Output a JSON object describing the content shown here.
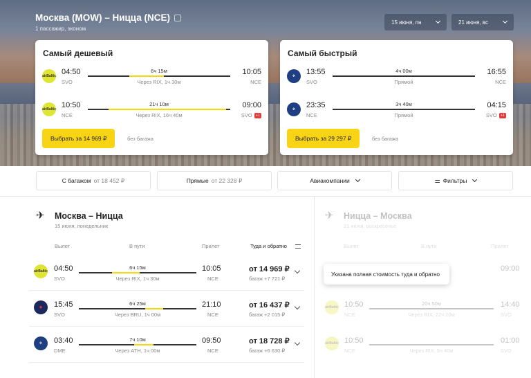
{
  "header": {
    "route": "Москва (MOW) – Ницца (NCE)",
    "subtitle": "1 пассажир, эконом",
    "date_out": "15 июня, пн",
    "date_back": "21 июня, вс"
  },
  "cheapest": {
    "title": "Самый дешевый",
    "flights": [
      {
        "logo": "airbaltic-logo",
        "logo_text": "airBaltic",
        "dep_time": "04:50",
        "dep_code": "SVO",
        "dur": "6ч 15м",
        "via": "Через RIX, 1ч 30м",
        "arr_time": "10:05",
        "arr_code": "NCE",
        "plus": ""
      },
      {
        "logo": "airbaltic-logo",
        "logo_text": "airBaltic",
        "dep_time": "10:50",
        "dep_code": "NCE",
        "dur": "21ч 10м",
        "via": "Через RIX, 16ч 40м",
        "arr_time": "09:00",
        "arr_code": "SVO",
        "plus": "+1"
      }
    ],
    "buy": "Выбрать за 14 969 ₽",
    "baggage": "без багажа"
  },
  "fastest": {
    "title": "Самый быстрый",
    "flights": [
      {
        "logo": "swiss-logo",
        "logo_text": "",
        "dep_time": "13:55",
        "dep_code": "SVO",
        "dur": "4ч 00м",
        "via": "Прямой",
        "arr_time": "16:55",
        "arr_code": "NCE",
        "plus": ""
      },
      {
        "logo": "swiss-logo",
        "logo_text": "",
        "dep_time": "23:35",
        "dep_code": "NCE",
        "dur": "3ч 40м",
        "via": "Прямой",
        "arr_time": "04:15",
        "arr_code": "SVO",
        "plus": "+1"
      }
    ],
    "buy": "Выбрать за 29 297 ₽",
    "baggage": "без багажа"
  },
  "filters": {
    "baggage": "С багажом",
    "baggage_price": "от 18 452 ₽",
    "direct": "Прямые",
    "direct_price": "от 22 328 ₽",
    "airlines": "Авиакомпании",
    "filters": "Фильтры"
  },
  "outbound": {
    "title": "Москва – Ницца",
    "date": "15 июня, понедельник",
    "cols": {
      "dep": "Вылет",
      "way": "В пути",
      "arr": "Прилет",
      "price": "Туда и обратно"
    },
    "rows": [
      {
        "logo_text": "airBaltic",
        "dep_time": "04:50",
        "dep_code": "SVO",
        "dur": "6ч 15м",
        "via": "Через RIX, 1ч 30м",
        "arr_time": "10:05",
        "arr_code": "NCE",
        "price": "от 14 969 ₽",
        "bag": "багаж +7 721 ₽"
      },
      {
        "logo_text": "",
        "dep_time": "15:45",
        "dep_code": "SVO",
        "dur": "6ч 25м",
        "via": "Через BRU, 1ч 00м",
        "arr_time": "21:10",
        "arr_code": "NCE",
        "price": "от 16 437 ₽",
        "bag": "багаж +2 015 ₽"
      },
      {
        "logo_text": "",
        "dep_time": "03:40",
        "dep_code": "DME",
        "dur": "7ч 10м",
        "via": "Через ATH, 1ч 00м",
        "arr_time": "09:50",
        "arr_code": "NCE",
        "price": "от 18 728 ₽",
        "bag": "багаж +6 630 ₽"
      }
    ]
  },
  "inbound": {
    "title": "Ницца – Москва",
    "date": "21 июня, воскресенье",
    "cols": {
      "dep": "Вылет",
      "way": "В пути",
      "arr": "Прилет"
    },
    "rows": [
      {
        "dep_time": "",
        "dep_code": "",
        "dur": "",
        "via": "",
        "arr_time": "09:00",
        "arr_code": ""
      },
      {
        "logo_text": "airBaltic",
        "dep_time": "10:50",
        "dep_code": "NCE",
        "dur": "20ч 50м",
        "via": "Через RIX, 22ч 20м",
        "arr_time": "14:40",
        "arr_code": "SVO"
      },
      {
        "logo_text": "airBaltic",
        "dep_time": "10:50",
        "dep_code": "NCE",
        "dur": "",
        "via": "Через RIX, 5ч 40м",
        "arr_time": "01:00",
        "arr_code": "SVO"
      }
    ]
  },
  "tooltip": "Указана полная стоимость туда и обратно"
}
